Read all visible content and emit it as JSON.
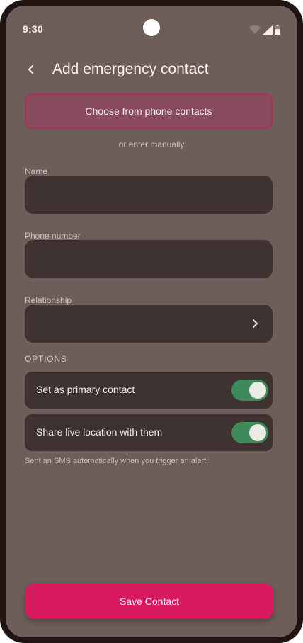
{
  "status_bar": {
    "time": "9:30",
    "icons": [
      "wifi-icon",
      "signal-icon",
      "battery-icon"
    ]
  },
  "header": {
    "back_icon": "chevron-left-icon",
    "title": "Add emergency contact"
  },
  "choose_button": {
    "label": "Choose from phone contacts"
  },
  "divider_text": "or enter manually",
  "form": {
    "name": {
      "label": "Name",
      "value": ""
    },
    "phone": {
      "label": "Phone number",
      "value": ""
    },
    "relationship": {
      "label": "Relationship",
      "value": "",
      "icon": "chevron-right-icon"
    }
  },
  "options": {
    "heading": "OPTIONS",
    "items": [
      {
        "label": "Set as primary contact",
        "enabled": true
      },
      {
        "label": "Share live location with them",
        "enabled": true
      }
    ],
    "hint": "Sent an SMS automatically when you trigger an alert."
  },
  "save_button": {
    "label": "Save Contact"
  },
  "colors": {
    "background": "#6e5e5a",
    "field": "#3f3331",
    "accent": "#d81b5f",
    "toggle_on": "#3e8a5b"
  }
}
